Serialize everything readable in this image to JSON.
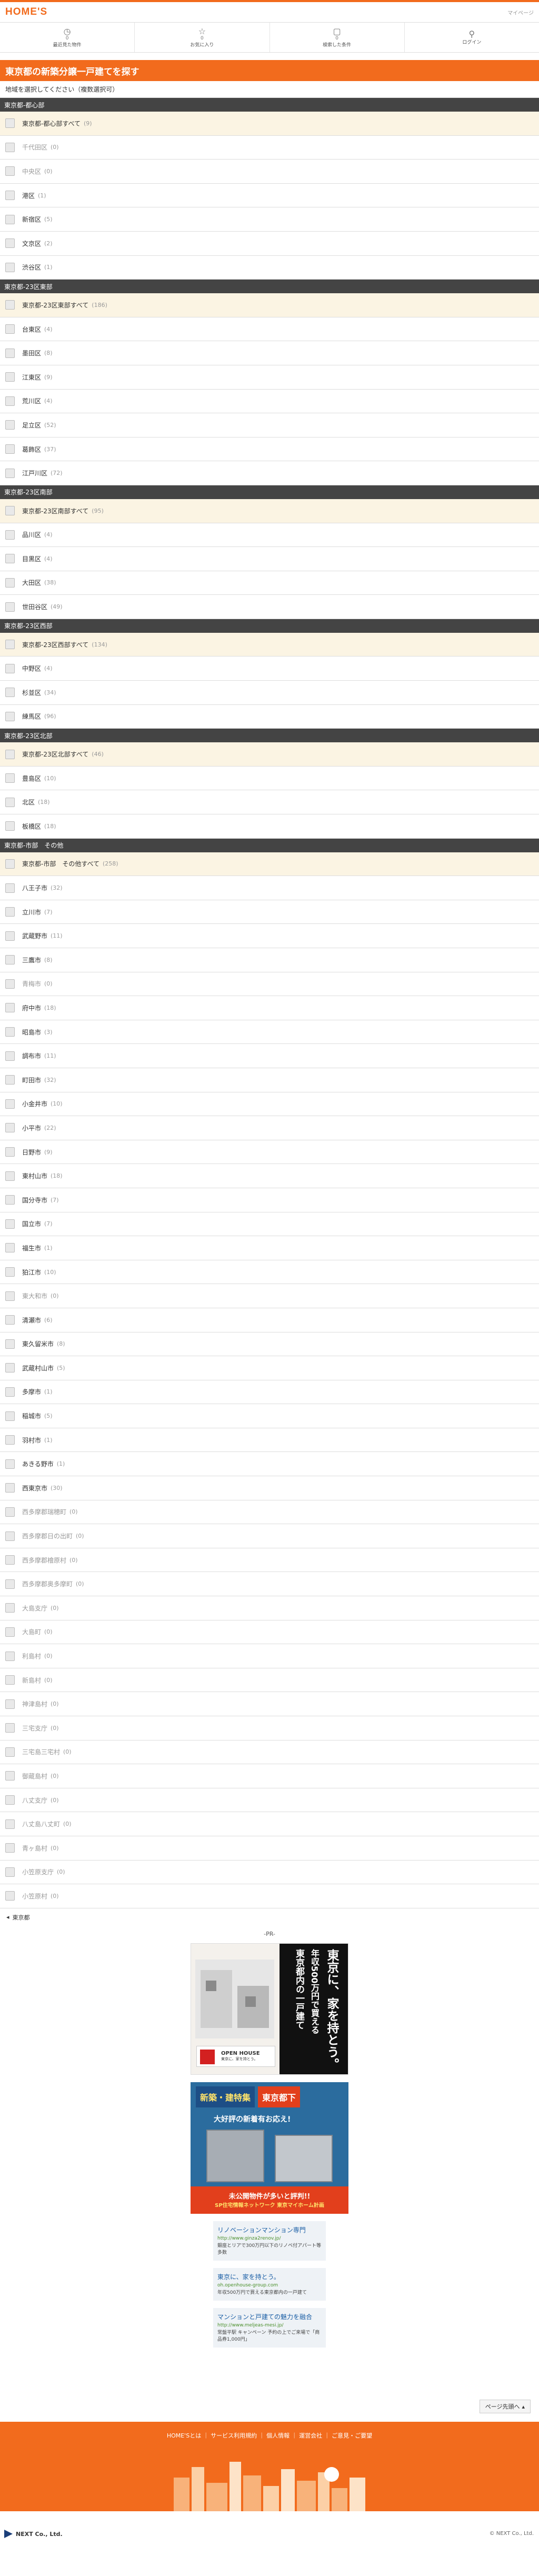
{
  "header": {
    "logo": "HOME'S",
    "top_link": "マイページ"
  },
  "nav": [
    {
      "icon": "clock-icon",
      "glyph": "◷",
      "count": "0",
      "label": "最近見た物件"
    },
    {
      "icon": "star-icon",
      "glyph": "☆",
      "count": "0",
      "label": "お気に入り"
    },
    {
      "icon": "chat-icon",
      "glyph": "▢",
      "count": "0",
      "label": "検索した条件"
    },
    {
      "icon": "person-icon",
      "glyph": "⚲",
      "count": "",
      "label": "ログイン"
    }
  ],
  "page_title": "東京都の新築分譲一戸建てを探す",
  "instruction": "地域を選択してください（複数選択可）",
  "groups": [
    {
      "name": "東京都-都心部",
      "items": [
        {
          "label": "東京都-都心部すべて",
          "count": "(9)",
          "all": true
        },
        {
          "label": "千代田区",
          "count": "(0)",
          "disabled": true
        },
        {
          "label": "中央区",
          "count": "(0)",
          "disabled": true
        },
        {
          "label": "港区",
          "count": "(1)"
        },
        {
          "label": "新宿区",
          "count": "(5)"
        },
        {
          "label": "文京区",
          "count": "(2)"
        },
        {
          "label": "渋谷区",
          "count": "(1)"
        }
      ]
    },
    {
      "name": "東京都-23区東部",
      "items": [
        {
          "label": "東京都-23区東部すべて",
          "count": "(186)",
          "all": true
        },
        {
          "label": "台東区",
          "count": "(4)"
        },
        {
          "label": "墨田区",
          "count": "(8)"
        },
        {
          "label": "江東区",
          "count": "(9)"
        },
        {
          "label": "荒川区",
          "count": "(4)"
        },
        {
          "label": "足立区",
          "count": "(52)"
        },
        {
          "label": "葛飾区",
          "count": "(37)"
        },
        {
          "label": "江戸川区",
          "count": "(72)"
        }
      ]
    },
    {
      "name": "東京都-23区南部",
      "items": [
        {
          "label": "東京都-23区南部すべて",
          "count": "(95)",
          "all": true
        },
        {
          "label": "品川区",
          "count": "(4)"
        },
        {
          "label": "目黒区",
          "count": "(4)"
        },
        {
          "label": "大田区",
          "count": "(38)"
        },
        {
          "label": "世田谷区",
          "count": "(49)"
        }
      ]
    },
    {
      "name": "東京都-23区西部",
      "items": [
        {
          "label": "東京都-23区西部すべて",
          "count": "(134)",
          "all": true
        },
        {
          "label": "中野区",
          "count": "(4)"
        },
        {
          "label": "杉並区",
          "count": "(34)"
        },
        {
          "label": "練馬区",
          "count": "(96)"
        }
      ]
    },
    {
      "name": "東京都-23区北部",
      "items": [
        {
          "label": "東京都-23区北部すべて",
          "count": "(46)",
          "all": true
        },
        {
          "label": "豊島区",
          "count": "(10)"
        },
        {
          "label": "北区",
          "count": "(18)"
        },
        {
          "label": "板橋区",
          "count": "(18)"
        }
      ]
    },
    {
      "name": "東京都-市部　その他",
      "items": [
        {
          "label": "東京都-市部　その他すべて",
          "count": "(258)",
          "all": true
        },
        {
          "label": "八王子市",
          "count": "(32)"
        },
        {
          "label": "立川市",
          "count": "(7)"
        },
        {
          "label": "武蔵野市",
          "count": "(11)"
        },
        {
          "label": "三鷹市",
          "count": "(8)"
        },
        {
          "label": "青梅市",
          "count": "(0)",
          "disabled": true
        },
        {
          "label": "府中市",
          "count": "(18)"
        },
        {
          "label": "昭島市",
          "count": "(3)"
        },
        {
          "label": "調布市",
          "count": "(11)"
        },
        {
          "label": "町田市",
          "count": "(32)"
        },
        {
          "label": "小金井市",
          "count": "(10)"
        },
        {
          "label": "小平市",
          "count": "(22)"
        },
        {
          "label": "日野市",
          "count": "(9)"
        },
        {
          "label": "東村山市",
          "count": "(18)"
        },
        {
          "label": "国分寺市",
          "count": "(7)"
        },
        {
          "label": "国立市",
          "count": "(7)"
        },
        {
          "label": "福生市",
          "count": "(1)"
        },
        {
          "label": "狛江市",
          "count": "(10)"
        },
        {
          "label": "東大和市",
          "count": "(0)",
          "disabled": true
        },
        {
          "label": "清瀬市",
          "count": "(6)"
        },
        {
          "label": "東久留米市",
          "count": "(8)"
        },
        {
          "label": "武蔵村山市",
          "count": "(5)"
        },
        {
          "label": "多摩市",
          "count": "(1)"
        },
        {
          "label": "稲城市",
          "count": "(5)"
        },
        {
          "label": "羽村市",
          "count": "(1)"
        },
        {
          "label": "あきる野市",
          "count": "(1)"
        },
        {
          "label": "西東京市",
          "count": "(30)"
        },
        {
          "label": "西多摩郡瑞穂町",
          "count": "(0)",
          "disabled": true
        },
        {
          "label": "西多摩郡日の出町",
          "count": "(0)",
          "disabled": true
        },
        {
          "label": "西多摩郡檜原村",
          "count": "(0)",
          "disabled": true
        },
        {
          "label": "西多摩郡奥多摩町",
          "count": "(0)",
          "disabled": true
        },
        {
          "label": "大島支庁",
          "count": "(0)",
          "disabled": true
        },
        {
          "label": "大島町",
          "count": "(0)",
          "disabled": true
        },
        {
          "label": "利島村",
          "count": "(0)",
          "disabled": true
        },
        {
          "label": "新島村",
          "count": "(0)",
          "disabled": true
        },
        {
          "label": "神津島村",
          "count": "(0)",
          "disabled": true
        },
        {
          "label": "三宅支庁",
          "count": "(0)",
          "disabled": true
        },
        {
          "label": "三宅島三宅村",
          "count": "(0)",
          "disabled": true
        },
        {
          "label": "御蔵島村",
          "count": "(0)",
          "disabled": true
        },
        {
          "label": "八丈支庁",
          "count": "(0)",
          "disabled": true
        },
        {
          "label": "八丈島八丈町",
          "count": "(0)",
          "disabled": true
        },
        {
          "label": "青ヶ島村",
          "count": "(0)",
          "disabled": true
        },
        {
          "label": "小笠原支庁",
          "count": "(0)",
          "disabled": true
        },
        {
          "label": "小笠原村",
          "count": "(0)",
          "disabled": true
        }
      ]
    }
  ],
  "back_link": "東京都",
  "pr_label": "-PR-",
  "ad1": {
    "vertical_main": "東京に、家を持とう。",
    "vertical_sub1": "年収500万円で買える",
    "vertical_sub2": "東京都内の一戸建て",
    "openhouse_title": "OPEN HOUSE",
    "openhouse_sub": "東京に、家を持とう。"
  },
  "ad2": {
    "badge1": "新築・建特集",
    "badge2": "東京都下",
    "subtitle": "大好評の新着有お応え!",
    "footer_main": "未公開物件が多いと評判!!",
    "footer_sub": "SP住宅情報ネットワーク 東京マイホーム計画"
  },
  "text_ads": [
    {
      "title": "リノベーションマンション専門",
      "url": "http://www.ginza2renov.jp/",
      "desc": "銀座とリアで300万円以下のリノベ付アパート等多数"
    },
    {
      "title": "東京に、家を持とう。",
      "url": "oh.openhouse-group.com",
      "desc": "年収500万円で買える東京都内の一戸建て"
    },
    {
      "title": "マンションと戸建ての魅力を融合",
      "url": "http://www.meljeas-mesi.jp/",
      "desc": "常盤平駅 キャンペーン 予約の上でご来場で「商品券1,000円」"
    }
  ],
  "page_top": "ページ先頭へ",
  "footer_links": "HOME'Sとは ｜ サービス利用規約 ｜ 個人情報 ｜ 運営会社 ｜ ご意見・ご要望",
  "company": "NEXT Co., Ltd.",
  "copyright": "© NEXT Co., Ltd.",
  "colors": {
    "accent": "#f26b1d",
    "group_header": "#444444",
    "all_row_bg": "#fbf4e3"
  }
}
